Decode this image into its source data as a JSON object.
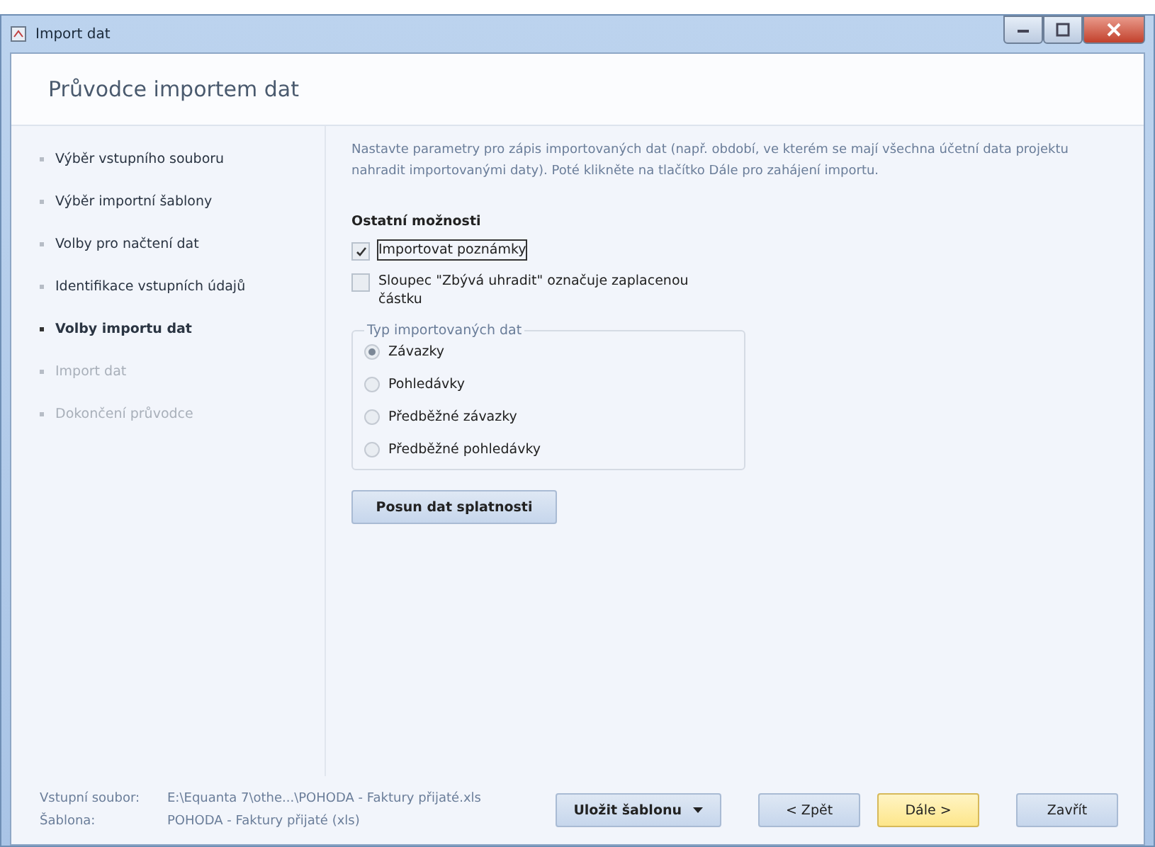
{
  "window": {
    "title": "Import dat"
  },
  "header": {
    "title": "Průvodce importem dat"
  },
  "steps": [
    {
      "label": "Výběr vstupního souboru",
      "selected": false,
      "disabled": false
    },
    {
      "label": "Výběr importní šablony",
      "selected": false,
      "disabled": false
    },
    {
      "label": "Volby pro načtení dat",
      "selected": false,
      "disabled": false
    },
    {
      "label": "Identifikace vstupních údajů",
      "selected": false,
      "disabled": false
    },
    {
      "label": "Volby importu dat",
      "selected": true,
      "disabled": false
    },
    {
      "label": "Import dat",
      "selected": false,
      "disabled": true
    },
    {
      "label": "Dokončení průvodce",
      "selected": false,
      "disabled": true
    }
  ],
  "description": "Nastavte parametry pro zápis importovaných dat (např. období, ve kterém se mají všechna účetní data projektu nahradit importovanými daty). Poté klikněte na tlačítko Dále pro zahájení importu.",
  "other_options": {
    "title": "Ostatní možnosti",
    "checkboxes": [
      {
        "label": "Importovat poznámky",
        "checked": true,
        "focused": true
      },
      {
        "label": "Sloupec \"Zbývá uhradit\" označuje zaplacenou částku",
        "checked": false,
        "focused": false
      }
    ]
  },
  "data_type": {
    "title": "Typ importovaných dat",
    "options": [
      {
        "label": "Závazky",
        "selected": true
      },
      {
        "label": "Pohledávky",
        "selected": false
      },
      {
        "label": "Předběžné závazky",
        "selected": false
      },
      {
        "label": "Předběžné pohledávky",
        "selected": false
      }
    ]
  },
  "shift_button": "Posun dat splatnosti",
  "footer": {
    "info": [
      {
        "label": "Vstupní soubor:",
        "value": "E:\\Equanta 7\\othe...\\POHODA - Faktury přijaté.xls"
      },
      {
        "label": "Šablona:",
        "value": "POHODA - Faktury přijaté (xls)"
      }
    ],
    "buttons": [
      {
        "label": "Uložit šablonu",
        "kind": "dropdown"
      },
      {
        "label": "< Zpět",
        "kind": "plain"
      },
      {
        "label": "Dále >",
        "kind": "default"
      },
      {
        "label": "Zavřít",
        "kind": "plain"
      }
    ]
  }
}
